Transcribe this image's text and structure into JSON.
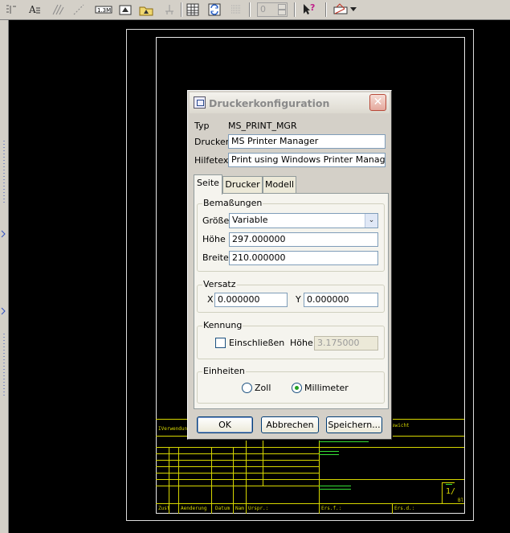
{
  "toolbar": {
    "spinner_value": "0",
    "icons": [
      "text-align-icon",
      "text-style-icon",
      "hatch-icon",
      "line-style-icon",
      "dimension-icon",
      "note-icon",
      "symbol-icon",
      "datum-icon",
      "table-icon",
      "refresh-icon",
      "grid-icon",
      "select-query-icon",
      "print-icon"
    ]
  },
  "drawing": {
    "title_block": {
      "usage_label": "IVerwendung",
      "weight_label": "ewicht",
      "sheet_ratio": "1/",
      "sheet_label": "Bl",
      "bottom_cells": [
        "Zust",
        "Aenderung",
        "Datum",
        "Nam",
        "Urspr.:",
        "Ers.f.:",
        "Ers.d.:"
      ]
    },
    "colors": {
      "background": "#000000",
      "title_block": "#d7d700",
      "highlight": "#35e035"
    }
  },
  "dialog": {
    "title": "Druckerkonfiguration",
    "type_label": "Typ",
    "type_value": "MS_PRINT_MGR",
    "printer_label": "Drucker",
    "printer_value": "MS Printer Manager",
    "help_label": "Hilfetext",
    "help_value": "Print using Windows Printer Manager.",
    "tabs": [
      {
        "label": "Seite",
        "active": true
      },
      {
        "label": "Drucker",
        "active": false
      },
      {
        "label": "Modell",
        "active": false
      }
    ],
    "dimensions": {
      "title": "Bemaßungen",
      "size_label": "Größe",
      "size_value": "Variable",
      "height_label": "Höhe",
      "height_value": "297.000000",
      "width_label": "Breite",
      "width_value": "210.000000"
    },
    "offset": {
      "title": "Versatz",
      "x_label": "X",
      "x_value": "0.000000",
      "y_label": "Y",
      "y_value": "0.000000"
    },
    "label_group": {
      "title": "Kennung",
      "include_label": "Einschließen",
      "include_checked": false,
      "height_label": "Höhe",
      "height_value": "3.175000"
    },
    "units": {
      "title": "Einheiten",
      "inch_label": "Zoll",
      "mm_label": "Millimeter",
      "selected": "Millimeter"
    },
    "buttons": {
      "ok": "OK",
      "cancel": "Abbrechen",
      "save": "Speichern..."
    }
  }
}
